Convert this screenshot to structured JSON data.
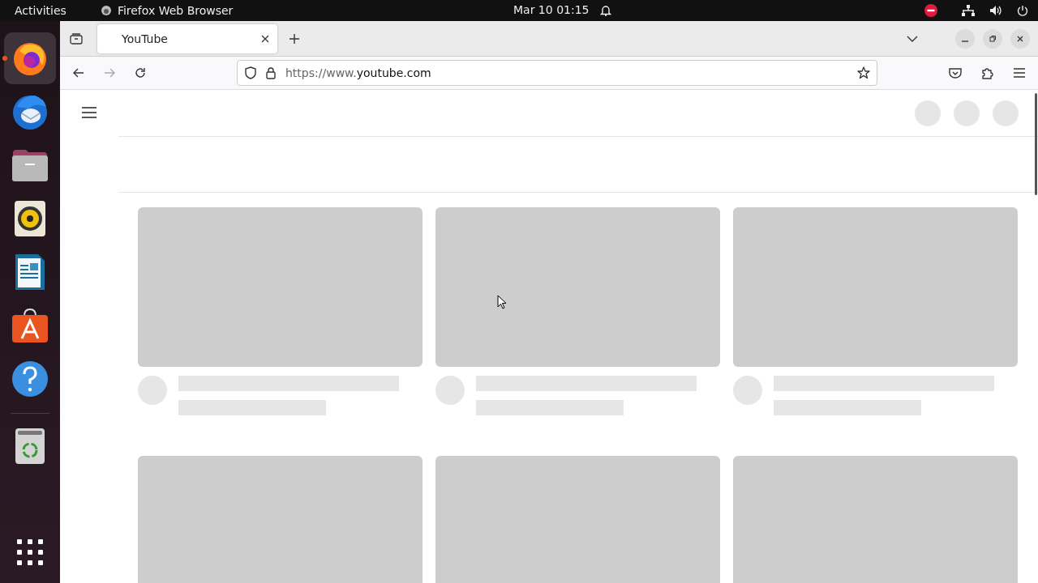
{
  "top_bar": {
    "activities": "Activities",
    "app_name": "Firefox Web Browser",
    "clock": "Mar 10  01:15"
  },
  "dock": [
    {
      "kind": "firefox",
      "selected": true,
      "running": true
    },
    {
      "kind": "mail",
      "selected": false,
      "running": false
    },
    {
      "kind": "files",
      "selected": false,
      "running": false
    },
    {
      "kind": "music",
      "selected": false,
      "running": false
    },
    {
      "kind": "writer",
      "selected": false,
      "running": false
    },
    {
      "kind": "store",
      "selected": false,
      "running": false
    },
    {
      "kind": "help",
      "selected": false,
      "running": false
    },
    {
      "kind": "trash",
      "selected": false,
      "running": false
    }
  ],
  "browser": {
    "tabs": [
      {
        "label": "YouTube",
        "selected": true
      }
    ],
    "url": {
      "scheme": "https://www.",
      "host": "youtube.com"
    }
  }
}
